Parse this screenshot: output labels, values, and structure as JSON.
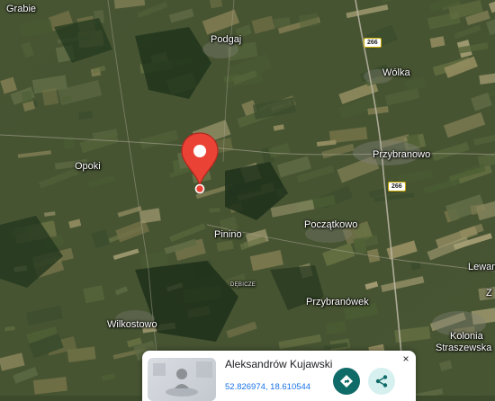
{
  "map": {
    "type": "satellite",
    "pin_color": "#ea4335",
    "places": [
      {
        "id": "grabie",
        "label": "Grabie"
      },
      {
        "id": "podgaj",
        "label": "Podgaj"
      },
      {
        "id": "wolka",
        "label": "Wólka"
      },
      {
        "id": "opoki",
        "label": "Opoki"
      },
      {
        "id": "przybranowo",
        "label": "Przybranowo"
      },
      {
        "id": "poczalkowo",
        "label": "Początkowo"
      },
      {
        "id": "pinino",
        "label": "Pinino"
      },
      {
        "id": "debicze",
        "label": "DĘBICZE"
      },
      {
        "id": "lewan",
        "label": "Lewan"
      },
      {
        "id": "przybranowek",
        "label": "Przybranówek"
      },
      {
        "id": "wilkostowo",
        "label": "Wilkostowo"
      },
      {
        "id": "kolonia",
        "label": "Kolonia"
      },
      {
        "id": "straszewska",
        "label": "Straszewska"
      },
      {
        "id": "z",
        "label": "Z"
      }
    ],
    "roads": [
      {
        "id": "road-266-north",
        "label": "266"
      },
      {
        "id": "road-266-south",
        "label": "266"
      }
    ]
  },
  "card": {
    "title": "Aleksandrów Kujawski",
    "coords": "52.826974, 18.610544",
    "close_label": "×",
    "directions_icon": "directions-icon",
    "share_icon": "share-icon",
    "accent": "#0f6b68"
  }
}
